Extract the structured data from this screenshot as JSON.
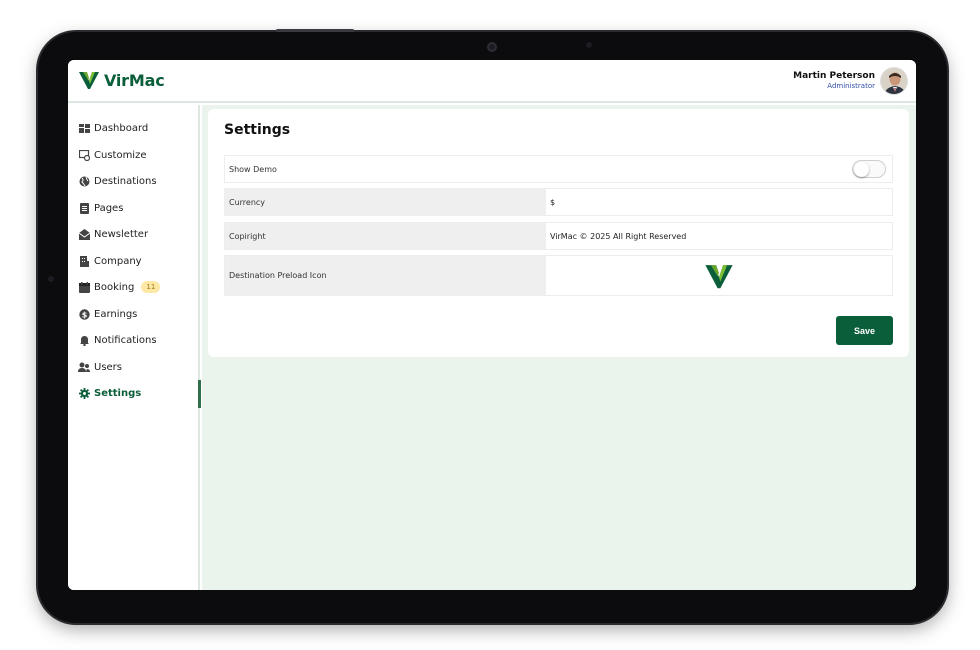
{
  "app": {
    "brand": "VirMac"
  },
  "user": {
    "name": "Martin Peterson",
    "role": "Administrator"
  },
  "sidebar": {
    "items": [
      {
        "label": "Dashboard",
        "icon": "dashboard-icon"
      },
      {
        "label": "Customize",
        "icon": "customize-icon"
      },
      {
        "label": "Destinations",
        "icon": "globe-icon"
      },
      {
        "label": "Pages",
        "icon": "pages-icon"
      },
      {
        "label": "Newsletter",
        "icon": "envelope-icon"
      },
      {
        "label": "Company",
        "icon": "building-icon"
      },
      {
        "label": "Booking",
        "icon": "calendar-icon",
        "badge": "11"
      },
      {
        "label": "Earnings",
        "icon": "dollar-icon"
      },
      {
        "label": "Notifications",
        "icon": "bell-icon"
      },
      {
        "label": "Users",
        "icon": "users-icon"
      },
      {
        "label": "Settings",
        "icon": "gear-icon",
        "active": true
      }
    ]
  },
  "settings": {
    "title": "Settings",
    "show_demo": {
      "label": "Show Demo",
      "enabled": false
    },
    "currency": {
      "label": "Currency",
      "value": "$"
    },
    "copyright": {
      "label": "Copiright",
      "value": "VirMac © 2025 All Right Reserved"
    },
    "preload_icon": {
      "label": "Destination Preload Icon",
      "icon": "virmac-logo-icon"
    },
    "save_label": "Save"
  },
  "colors": {
    "brand": "#0b5e3a",
    "background": "#eaf3ec",
    "badge": "#fde8a6"
  }
}
